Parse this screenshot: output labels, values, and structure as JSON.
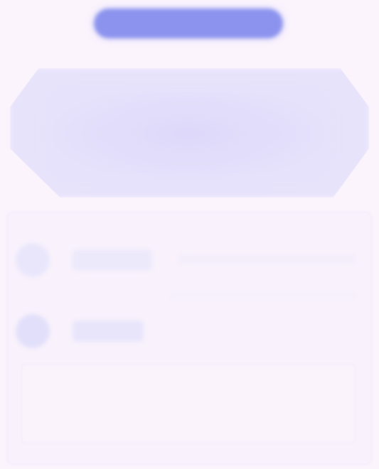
{
  "header": {
    "button_label": ""
  },
  "hero": {
    "title": ""
  },
  "list": {
    "items": [
      {
        "label": "",
        "icon": "avatar-icon"
      },
      {
        "label": "",
        "icon": "avatar-icon"
      }
    ]
  },
  "input": {
    "value": "",
    "placeholder": ""
  },
  "colors": {
    "background": "#fbf4fd",
    "accent": "#8b93ee",
    "hero": "#e6e2fb",
    "panel": "#f9f2fc"
  }
}
